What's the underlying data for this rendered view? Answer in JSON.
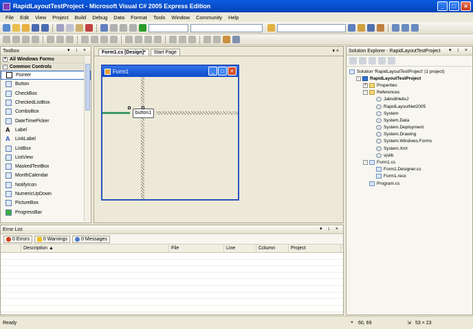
{
  "window": {
    "title": "RapidLayoutTestProject - Microsoft Visual C# 2005 Express Edition",
    "min": "_",
    "max": "□",
    "close": "×"
  },
  "menu": [
    "File",
    "Edit",
    "View",
    "Project",
    "Build",
    "Debug",
    "Data",
    "Format",
    "Tools",
    "Window",
    "Community",
    "Help"
  ],
  "toolbox": {
    "title": "Toolbox",
    "controls": "▾ ↕ ×",
    "groups": {
      "all": "All Windows Forms",
      "common": "Common Controls"
    },
    "items": [
      "Pointer",
      "Button",
      "CheckBox",
      "CheckedListBox",
      "ComboBox",
      "DateTimePicker",
      "Label",
      "LinkLabel",
      "ListBox",
      "ListView",
      "MaskedTextBox",
      "MonthCalendar",
      "NotifyIcon",
      "NumericUpDown",
      "PictureBox",
      "ProgressBar"
    ]
  },
  "designer": {
    "tabs": [
      "Form1.cs [Design]*",
      "Start Page"
    ],
    "close": "▾ ×",
    "form_title": "Form1",
    "button_text": "button1"
  },
  "solution_explorer": {
    "title": "Solution Explorer - RapidLayoutTestProject",
    "controls": "▾ ↕ ×",
    "items": [
      {
        "text": "Solution 'RapidLayoutTestProject' (1 project)",
        "indent": 0,
        "icon": "solution",
        "exp": ""
      },
      {
        "text": "RapidLayoutTestProject",
        "indent": 1,
        "icon": "proj",
        "exp": "-",
        "bold": true
      },
      {
        "text": "Properties",
        "indent": 2,
        "icon": "folder",
        "exp": "+"
      },
      {
        "text": "References",
        "indent": 2,
        "icon": "folder",
        "exp": "-"
      },
      {
        "text": "JalindiHelixJ",
        "indent": 3,
        "icon": "ref",
        "exp": ""
      },
      {
        "text": "RapidLayoutNet2005",
        "indent": 3,
        "icon": "ref",
        "exp": ""
      },
      {
        "text": "System",
        "indent": 3,
        "icon": "ref",
        "exp": ""
      },
      {
        "text": "System.Data",
        "indent": 3,
        "icon": "ref",
        "exp": ""
      },
      {
        "text": "System.Deployment",
        "indent": 3,
        "icon": "ref",
        "exp": ""
      },
      {
        "text": "System.Drawing",
        "indent": 3,
        "icon": "ref",
        "exp": ""
      },
      {
        "text": "System.Windows.Forms",
        "indent": 3,
        "icon": "ref",
        "exp": ""
      },
      {
        "text": "System.Xml",
        "indent": 3,
        "icon": "ref",
        "exp": ""
      },
      {
        "text": "vjslib",
        "indent": 3,
        "icon": "ref",
        "exp": ""
      },
      {
        "text": "Form1.cs",
        "indent": 2,
        "icon": "form",
        "exp": "-"
      },
      {
        "text": "Form1.Designer.cs",
        "indent": 3,
        "icon": "cs",
        "exp": ""
      },
      {
        "text": "Form1.resx",
        "indent": 3,
        "icon": "cs",
        "exp": ""
      },
      {
        "text": "Program.cs",
        "indent": 2,
        "icon": "cs",
        "exp": ""
      }
    ]
  },
  "error_list": {
    "title": "Error List",
    "controls": "▾ ↕ ×",
    "errors": "0 Errors",
    "warnings": "0 Warnings",
    "messages": "0 Messages",
    "columns": [
      "Description",
      "File",
      "Line",
      "Column",
      "Project"
    ]
  },
  "status": {
    "text": "Ready",
    "position": "60, 69",
    "size": "53 × 23"
  }
}
